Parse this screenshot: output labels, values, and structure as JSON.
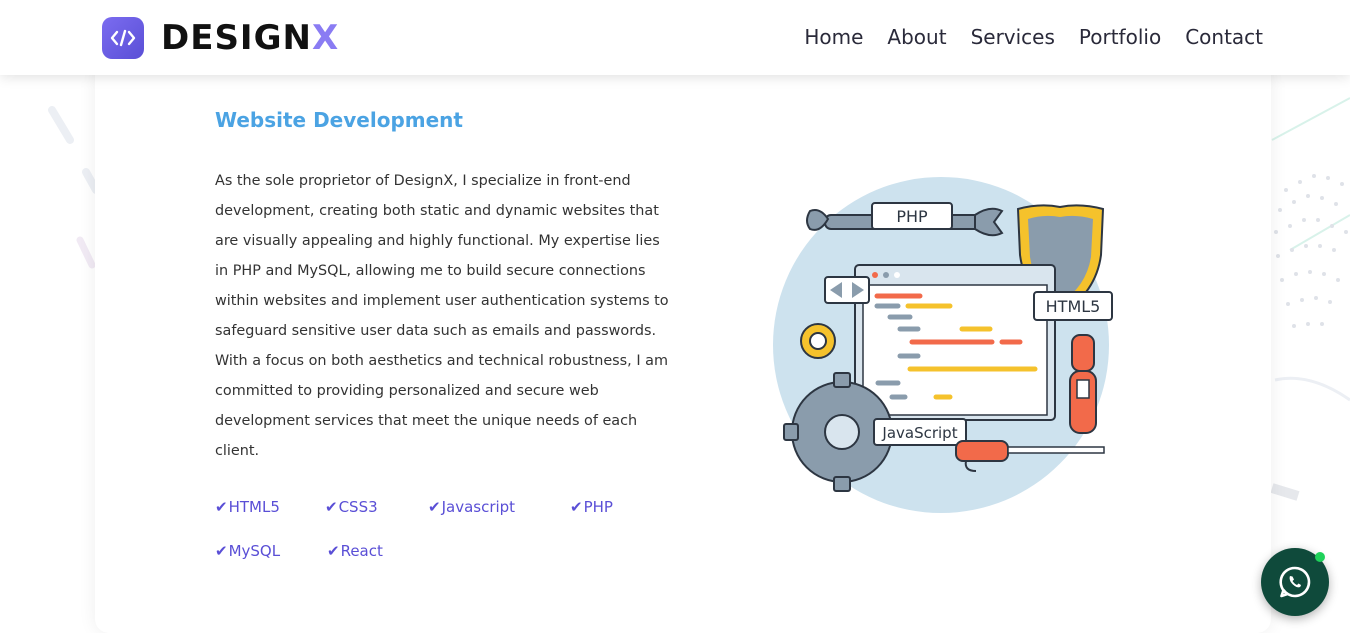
{
  "header": {
    "logo_text_main": "DESIGN",
    "logo_text_accent": "X",
    "nav": [
      {
        "label": "Home"
      },
      {
        "label": "About"
      },
      {
        "label": "Services"
      },
      {
        "label": "Portfolio"
      },
      {
        "label": "Contact"
      }
    ]
  },
  "section": {
    "title": "Website Development",
    "description": "As the sole proprietor of DesignX, I specialize in front-end development, creating both static and dynamic websites that are visually appealing and highly functional. My expertise lies in PHP and MySQL, allowing me to build secure connections within websites and implement user authentication systems to safeguard sensitive user data such as emails and passwords. With a focus on both aesthetics and technical robustness, I am committed to providing personalized and secure web development services that meet the unique needs of each client.",
    "tech": [
      {
        "label": "HTML5"
      },
      {
        "label": "CSS3"
      },
      {
        "label": "Javascript"
      },
      {
        "label": "PHP"
      },
      {
        "label": "MySQL"
      },
      {
        "label": "React"
      }
    ]
  },
  "illustration": {
    "labels": {
      "php": "PHP",
      "html5": "HTML5",
      "javascript": "JavaScript"
    }
  },
  "colors": {
    "accent": "#5a4fd6",
    "title": "#4ba3e3",
    "chat": "#0f4a3b",
    "online": "#1fd15a"
  },
  "icons": {
    "logo": "code-icon",
    "check": "check-icon",
    "chat": "whatsapp-icon"
  }
}
